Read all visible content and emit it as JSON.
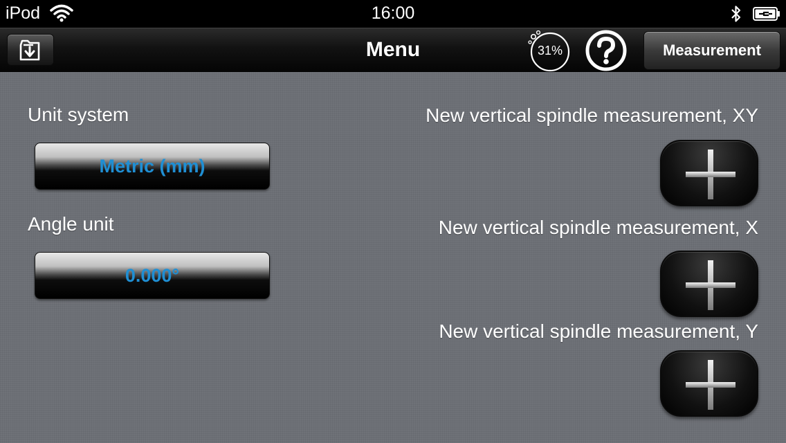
{
  "status_bar": {
    "carrier": "iPod",
    "time": "16:00",
    "icons": [
      "wifi-icon",
      "bluetooth-icon",
      "battery-charging-icon"
    ]
  },
  "nav_bar": {
    "title": "Menu",
    "left_button_icon": "folder-download-icon",
    "progress_percent": "31%",
    "help_icon": "help-icon",
    "right_button_label": "Measurement"
  },
  "settings": {
    "unit_system_label": "Unit system",
    "unit_system_value": "Metric (mm)",
    "angle_unit_label": "Angle unit",
    "angle_unit_value": "0.000°"
  },
  "measurements": [
    {
      "label": "New vertical spindle measurement, XY",
      "icon": "plus-icon"
    },
    {
      "label": "New vertical spindle measurement, X",
      "icon": "plus-icon"
    },
    {
      "label": "New vertical spindle measurement, Y",
      "icon": "plus-icon"
    }
  ],
  "colors": {
    "accent_blue": "#1f8fd4",
    "background": "#6c6f75",
    "bar_black": "#000000"
  }
}
